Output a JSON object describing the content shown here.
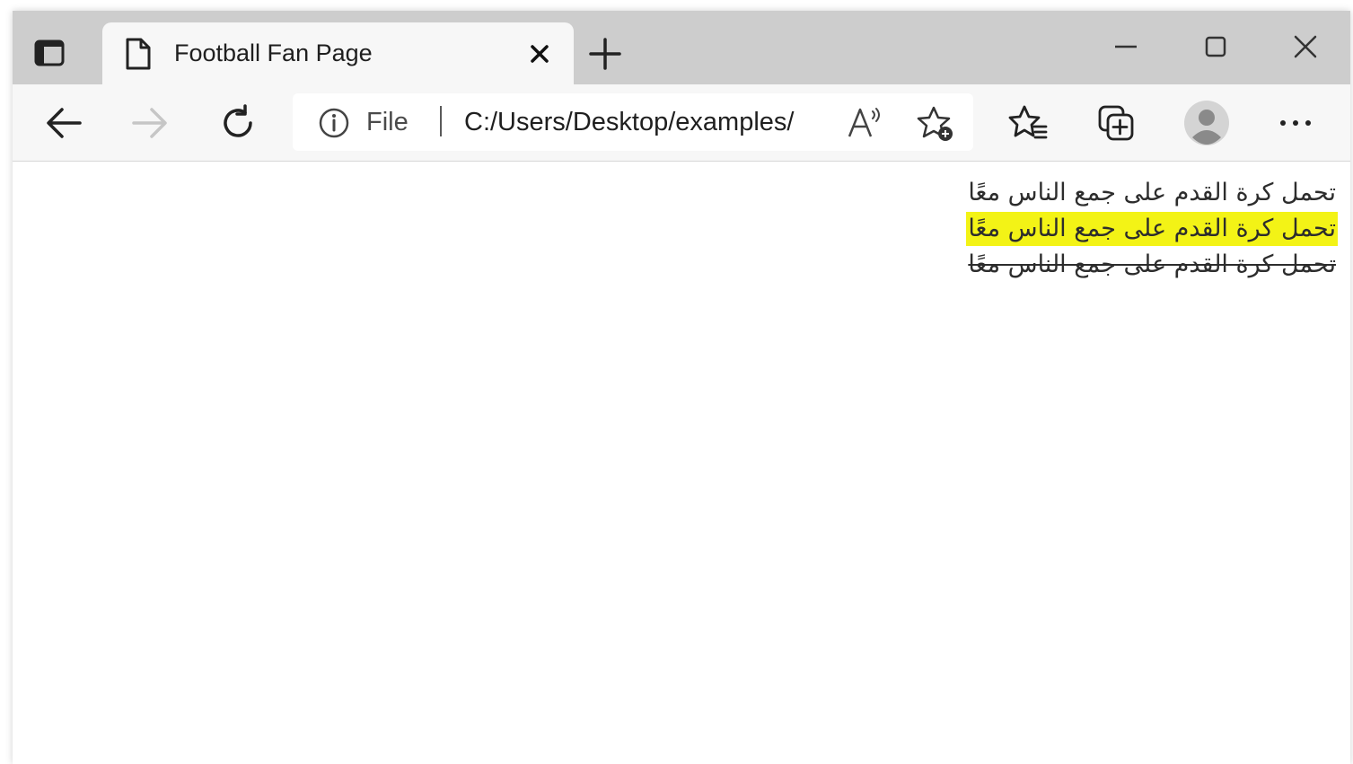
{
  "browser": {
    "tab": {
      "title": "Football Fan Page",
      "icon": "page-icon"
    },
    "address": {
      "scheme_label": "File",
      "url": "C:/Users/Desktop/examples/"
    },
    "toolbar_icons": [
      "back-icon",
      "forward-icon",
      "refresh-icon",
      "info-icon",
      "read-aloud-icon",
      "add-favorite-icon",
      "favorites-icon",
      "collections-icon",
      "profile-avatar",
      "more-icon"
    ],
    "window_controls": [
      "minimize-icon",
      "maximize-icon",
      "close-icon"
    ]
  },
  "content": {
    "lines": [
      {
        "text": "تحمل كرة القدم على جمع الناس معًا",
        "style": "normal"
      },
      {
        "text": "تحمل كرة القدم على جمع الناس معًا",
        "style": "highlighted",
        "highlight_color": "#f3f316"
      },
      {
        "text": "تحمل كرة القدم على جمع الناس معًا",
        "style": "strikethrough"
      }
    ]
  },
  "colors": {
    "tabstrip": "#cdcdcd",
    "toolbar": "#f7f7f7",
    "highlight": "#f3f316"
  }
}
